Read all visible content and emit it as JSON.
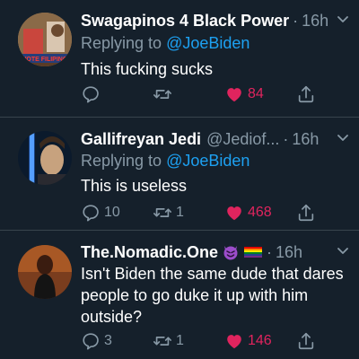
{
  "tweets": [
    {
      "name": "Swagapinos 4 Black Power",
      "handle": "",
      "time": "16h",
      "reply_prefix": "Replying to ",
      "reply_to": "@JoeBiden",
      "avatar_caption": "VOTE FILIPINO",
      "text": "This fucking sucks",
      "replies": "",
      "retweets": "",
      "likes": "84",
      "liked": true
    },
    {
      "name": "Gallifreyan Jedi",
      "handle": "@Jediof...",
      "time": "16h",
      "reply_prefix": "Replying to ",
      "reply_to": "@JoeBiden",
      "text": "This is useless",
      "replies": "10",
      "retweets": "1",
      "likes": "468",
      "liked": true
    },
    {
      "name": "The.Nomadic.One",
      "handle": "",
      "time": "16h",
      "badges": [
        "smiling-devil-emoji",
        "rainbow-flag-emoji"
      ],
      "text": "Isn't Biden the same dude that dares people to go duke it up with him outside?",
      "replies": "3",
      "retweets": "1",
      "likes": "146",
      "liked": true
    }
  ],
  "colors": {
    "background": "#15202b",
    "muted": "#8899a6",
    "link": "#1da1f2",
    "like": "#e0245e",
    "divider": "#38444d"
  }
}
